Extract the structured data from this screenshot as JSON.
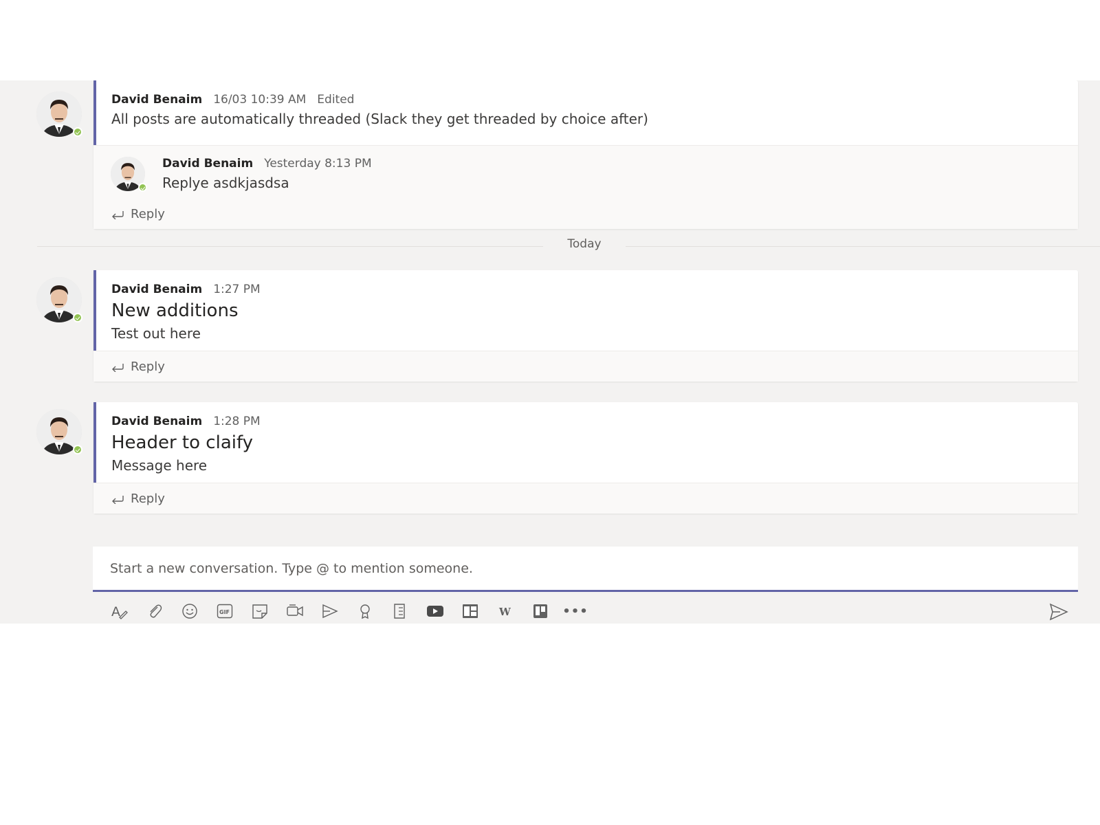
{
  "day_divider": "Today",
  "threads": [
    {
      "author": "David Benaim",
      "time": "16/03 10:39 AM",
      "edited": "Edited",
      "text": "All posts are automatically threaded (Slack they get threaded by choice after)",
      "replies": [
        {
          "author": "David Benaim",
          "time": "Yesterday 8:13 PM",
          "text": "Replye asdkjasdsa"
        }
      ],
      "reply_label": "Reply"
    },
    {
      "author": "David Benaim",
      "time": "1:27 PM",
      "subject": "New additions",
      "text": "Test out here",
      "reply_label": "Reply"
    },
    {
      "author": "David Benaim",
      "time": "1:28 PM",
      "subject": "Header to claify",
      "text": "Message here",
      "reply_label": "Reply"
    }
  ],
  "composer": {
    "placeholder": "Start a new conversation. Type @ to mention someone."
  },
  "toolbar": {
    "icons": [
      "format-icon",
      "attach-icon",
      "emoji-icon",
      "gif-icon",
      "sticker-icon",
      "meet-now-icon",
      "stream-icon",
      "praise-icon",
      "forms-icon",
      "youtube-icon",
      "planner-icon",
      "wiki-icon",
      "trello-icon",
      "more-options-icon"
    ],
    "send_icon": "send-icon",
    "more_label": "•••",
    "gif_label": "GIF",
    "wiki_label": "W"
  },
  "colors": {
    "accent": "#6264a7",
    "presence": "#92c353",
    "background": "#f3f2f1"
  }
}
